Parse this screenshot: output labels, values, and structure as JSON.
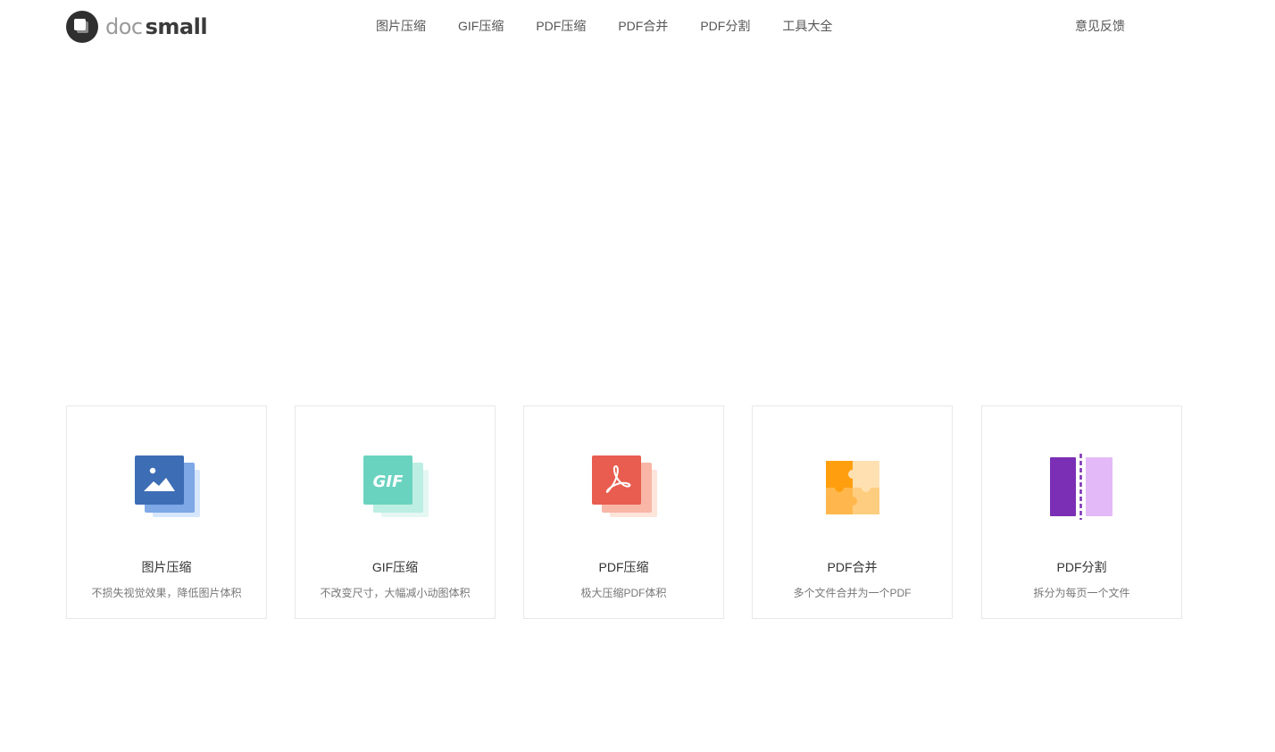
{
  "header": {
    "logo": {
      "text_light": "doc",
      "text_bold": "small"
    },
    "nav": [
      {
        "label": "图片压缩"
      },
      {
        "label": "GIF压缩"
      },
      {
        "label": "PDF压缩"
      },
      {
        "label": "PDF合并"
      },
      {
        "label": "PDF分割"
      },
      {
        "label": "工具大全"
      }
    ],
    "feedback": "意见反馈"
  },
  "tools": [
    {
      "title": "图片压缩",
      "desc": "不损失视觉效果，降低图片体积",
      "icon": "image-compress-icon",
      "color": "#3d6db5"
    },
    {
      "title": "GIF压缩",
      "desc": "不改变尺寸，大幅减小动图体积",
      "icon": "gif-compress-icon",
      "color": "#6ad3c0",
      "icon_text": "GIF"
    },
    {
      "title": "PDF压缩",
      "desc": "极大压缩PDF体积",
      "icon": "pdf-compress-icon",
      "color": "#e85d4f"
    },
    {
      "title": "PDF合并",
      "desc": "多个文件合并为一个PDF",
      "icon": "puzzle-merge-icon",
      "color": "#ffa726"
    },
    {
      "title": "PDF分割",
      "desc": "拆分为每页一个文件",
      "icon": "pdf-split-icon",
      "color": "#7b2fb5"
    }
  ]
}
